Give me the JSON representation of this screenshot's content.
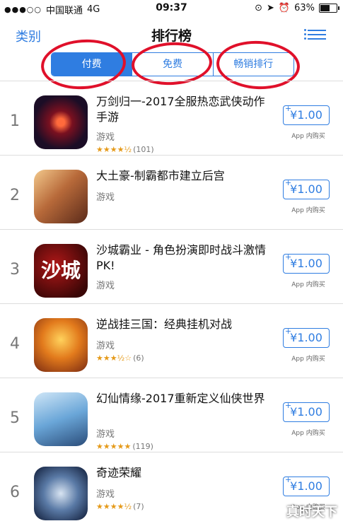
{
  "status_bar": {
    "signal": "●●●○○",
    "carrier": "中国联通",
    "network": "4G",
    "time": "09:37",
    "battery": "63%",
    "battery_level": 0.63
  },
  "nav": {
    "back_label": "类别",
    "title": "排行榜",
    "menu_icon": "list-icon"
  },
  "segments": [
    {
      "label": "付费",
      "active": true
    },
    {
      "label": "免费",
      "active": false
    },
    {
      "label": "畅销排行",
      "active": false
    }
  ],
  "colors": {
    "accent": "#2f7de1",
    "annotation_red": "#e0102a",
    "star": "#e59a1a"
  },
  "apps": [
    {
      "rank": "1",
      "name": "万剑归一-2017全服热恋武侠动作手游",
      "category": "游戏",
      "stars": "★★★★½",
      "rating_value": 4.5,
      "rating_count": "(101)",
      "price": "¥1.00",
      "iap": "App 内购买"
    },
    {
      "rank": "2",
      "name": "大土豪-制霸都市建立后宫",
      "category": "游戏",
      "stars": "",
      "rating_value": null,
      "rating_count": "",
      "price": "¥1.00",
      "iap": "App 内购买"
    },
    {
      "rank": "3",
      "name": "沙城霸业 - 角色扮演即时战斗激情PK!",
      "category": "游戏",
      "stars": "",
      "rating_value": null,
      "rating_count": "",
      "price": "¥1.00",
      "iap": "App 内购买",
      "icon_text": "沙城"
    },
    {
      "rank": "4",
      "name": "逆战挂三国：经典挂机对战",
      "category": "游戏",
      "stars": "★★★½☆",
      "rating_value": 3.5,
      "rating_count": "(6)",
      "price": "¥1.00",
      "iap": "App 内购买"
    },
    {
      "rank": "5",
      "name": "幻仙情缘-2017重新定义仙侠世界",
      "category": "游戏",
      "stars": "★★★★★",
      "rating_value": 5,
      "rating_count": "(119)",
      "price": "¥1.00",
      "iap": "App 内购买"
    },
    {
      "rank": "6",
      "name": "奇迹荣耀",
      "category": "游戏",
      "stars": "★★★★½",
      "rating_value": 4.5,
      "rating_count": "(7)",
      "price": "¥1.00",
      "iap": "App 内购买"
    }
  ],
  "watermark": "真时天下"
}
